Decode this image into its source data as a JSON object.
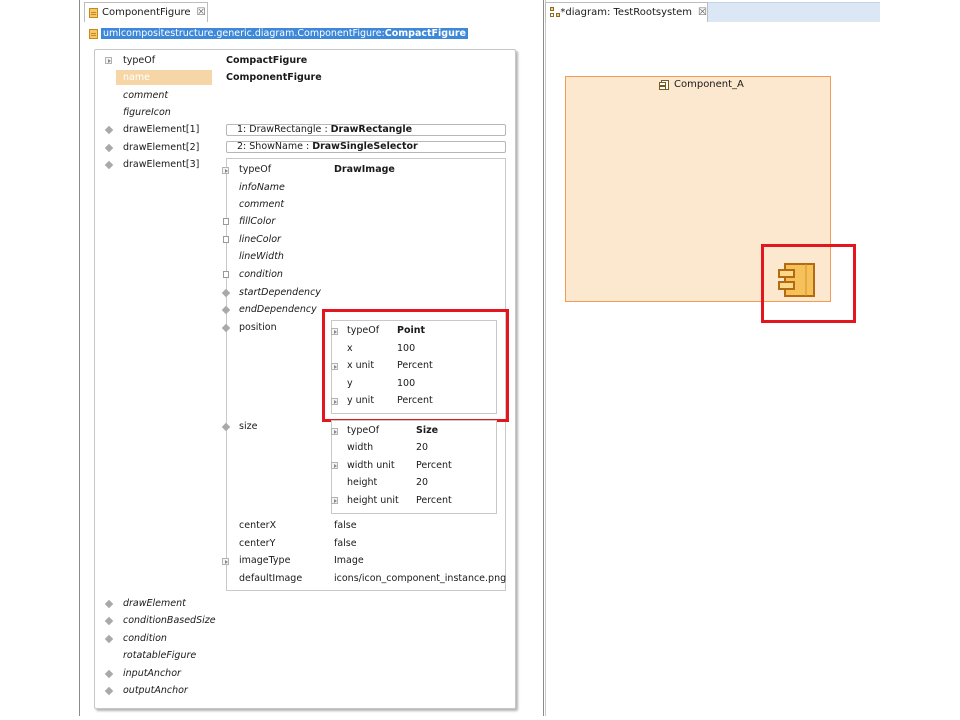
{
  "left_tab": {
    "title": "ComponentFigure",
    "close": "☒"
  },
  "right_tab": {
    "title": "*diagram: TestRootsystem",
    "close": "☒"
  },
  "breadcrumb": {
    "prefix": "umlcompositestructure.generic.diagram.ComponentFigure:",
    "selected": "CompactFigure"
  },
  "root": {
    "typeOf": {
      "label": "typeOf",
      "value": "CompactFigure"
    },
    "name": {
      "label": "name",
      "value": "ComponentFigure"
    },
    "comment": {
      "label": "comment"
    },
    "figureIcon": {
      "label": "figureIcon"
    },
    "drawElement1": {
      "label": "drawElement[1]",
      "summary_index": "1: DrawRectangle",
      "summary_sep": ":",
      "summary_type": "DrawRectangle"
    },
    "drawElement2": {
      "label": "drawElement[2]",
      "summary_index": "2: ShowName",
      "summary_sep": ":",
      "summary_type": "DrawSingleSelector"
    },
    "drawElement3": {
      "label": "drawElement[3]"
    },
    "drawElement": {
      "label": "drawElement"
    },
    "conditionBasedSize": {
      "label": "conditionBasedSize"
    },
    "condition": {
      "label": "condition"
    },
    "rotatableFigure": {
      "label": "rotatableFigure"
    },
    "inputAnchor": {
      "label": "inputAnchor"
    },
    "outputAnchor": {
      "label": "outputAnchor"
    }
  },
  "draw_image": {
    "typeOf": {
      "label": "typeOf",
      "value": "DrawImage"
    },
    "infoName": {
      "label": "infoName"
    },
    "comment": {
      "label": "comment"
    },
    "fillColor": {
      "label": "fillColor"
    },
    "lineColor": {
      "label": "lineColor"
    },
    "lineWidth": {
      "label": "lineWidth"
    },
    "condition": {
      "label": "condition"
    },
    "startDependency": {
      "label": "startDependency"
    },
    "endDependency": {
      "label": "endDependency"
    },
    "position": {
      "label": "position"
    },
    "size": {
      "label": "size"
    },
    "centerX": {
      "label": "centerX",
      "value": "false"
    },
    "centerY": {
      "label": "centerY",
      "value": "false"
    },
    "imageType": {
      "label": "imageType",
      "value": "Image"
    },
    "defaultImage": {
      "label": "defaultImage",
      "value": "icons/icon_component_instance.png"
    }
  },
  "position": {
    "typeOf": {
      "label": "typeOf",
      "value": "Point"
    },
    "x": {
      "label": "x",
      "value": "100"
    },
    "x_unit": {
      "label": "x unit",
      "value": "Percent"
    },
    "y": {
      "label": "y",
      "value": "100"
    },
    "y_unit": {
      "label": "y unit",
      "value": "Percent"
    }
  },
  "size": {
    "typeOf": {
      "label": "typeOf",
      "value": "Size"
    },
    "width": {
      "label": "width",
      "value": "20"
    },
    "width_unit": {
      "label": "width unit",
      "value": "Percent"
    },
    "height": {
      "label": "height",
      "value": "20"
    },
    "height_unit": {
      "label": "height unit",
      "value": "Percent"
    }
  },
  "diagram": {
    "component_name": "Component_A"
  },
  "colors": {
    "highlight": "#e3151e",
    "component_fill": "#fbe8cf",
    "component_border": "#ef9c5a",
    "selection": "#3e88d9"
  }
}
